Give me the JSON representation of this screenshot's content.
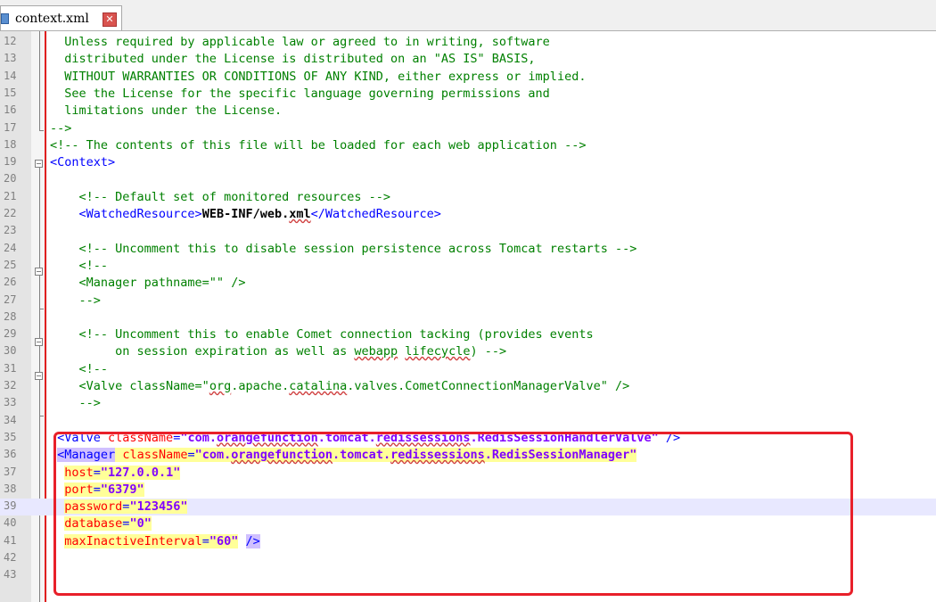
{
  "tab": {
    "title": "context.xml",
    "icon": "xml-file-icon",
    "close_icon": "close-icon"
  },
  "colors": {
    "comment": "#008000",
    "tag": "#0000ff",
    "attr": "#ff0000",
    "value": "#8000ff",
    "highlight": "#ffff99",
    "box": "#e8202a"
  },
  "lines": [
    {
      "n": "12",
      "segs": [
        {
          "t": "  Unless required by applicable law or agreed to in writing, software",
          "k": "c"
        }
      ]
    },
    {
      "n": "13",
      "segs": [
        {
          "t": "  distributed under the License is distributed on an \"AS IS\" BASIS,",
          "k": "c"
        }
      ]
    },
    {
      "n": "14",
      "segs": [
        {
          "t": "  WITHOUT WARRANTIES OR CONDITIONS OF ANY KIND, either express or implied.",
          "k": "c"
        }
      ]
    },
    {
      "n": "15",
      "segs": [
        {
          "t": "  See the License for the specific language governing permissions and",
          "k": "c"
        }
      ]
    },
    {
      "n": "16",
      "segs": [
        {
          "t": "  limitations under the License.",
          "k": "c"
        }
      ]
    },
    {
      "n": "17",
      "segs": [
        {
          "t": "-->",
          "k": "c"
        }
      ]
    },
    {
      "n": "18",
      "segs": [
        {
          "t": "<!-- The contents of this file will be loaded for each web application -->",
          "k": "c"
        }
      ]
    },
    {
      "n": "19",
      "segs": [
        {
          "t": "<Context>",
          "k": "t"
        }
      ]
    },
    {
      "n": "20",
      "segs": []
    },
    {
      "n": "21",
      "segs": [
        {
          "t": "    <!-- Default set of monitored resources -->",
          "k": "c"
        }
      ]
    },
    {
      "n": "22",
      "segs": [
        {
          "t": "    <WatchedResource>",
          "k": "t"
        },
        {
          "t": "WEB-INF/web.",
          "k": "b"
        },
        {
          "t": "xml",
          "k": "bsq"
        },
        {
          "t": "</WatchedResource>",
          "k": "t"
        }
      ]
    },
    {
      "n": "23",
      "segs": []
    },
    {
      "n": "24",
      "segs": [
        {
          "t": "    <!-- Uncomment this to disable session persistence across Tomcat restarts -->",
          "k": "c"
        }
      ]
    },
    {
      "n": "25",
      "segs": [
        {
          "t": "    <!--",
          "k": "c"
        }
      ]
    },
    {
      "n": "26",
      "segs": [
        {
          "t": "    <Manager pathname=\"\" />",
          "k": "c"
        }
      ]
    },
    {
      "n": "27",
      "segs": [
        {
          "t": "    -->",
          "k": "c"
        }
      ]
    },
    {
      "n": "28",
      "segs": []
    },
    {
      "n": "29",
      "segs": [
        {
          "t": "    <!-- Uncomment this to enable Comet connection tacking (provides events",
          "k": "c"
        }
      ]
    },
    {
      "n": "30",
      "segs": [
        {
          "t": "         on session expiration as well as ",
          "k": "c"
        },
        {
          "t": "webapp",
          "k": "csq"
        },
        {
          "t": " ",
          "k": "c"
        },
        {
          "t": "lifecycle",
          "k": "csq"
        },
        {
          "t": ") -->",
          "k": "c"
        }
      ]
    },
    {
      "n": "31",
      "segs": [
        {
          "t": "    <!--",
          "k": "c"
        }
      ]
    },
    {
      "n": "32",
      "segs": [
        {
          "t": "    <Valve className=\"",
          "k": "c"
        },
        {
          "t": "org",
          "k": "csq"
        },
        {
          "t": ".apache.",
          "k": "c"
        },
        {
          "t": "catalina",
          "k": "csq"
        },
        {
          "t": ".valves.CometConnectionManagerValve\" />",
          "k": "c"
        }
      ]
    },
    {
      "n": "33",
      "segs": [
        {
          "t": "    -->",
          "k": "c"
        }
      ]
    },
    {
      "n": "34",
      "segs": []
    },
    {
      "n": "35",
      "segs": [
        {
          "t": " <Valve ",
          "k": "t"
        },
        {
          "t": "className",
          "k": "a"
        },
        {
          "t": "=",
          "k": "t"
        },
        {
          "t": "\"com.",
          "k": "v"
        },
        {
          "t": "orangefunction",
          "k": "vsq"
        },
        {
          "t": ".tomcat.",
          "k": "v"
        },
        {
          "t": "redissessions",
          "k": "vsq"
        },
        {
          "t": ".RedisSessionHandlerValve\"",
          "k": "v"
        },
        {
          "t": " />",
          "k": "t"
        }
      ]
    },
    {
      "n": "36",
      "segs": [
        {
          "t": " ",
          "k": "t"
        },
        {
          "t": "<Manager",
          "k": "thp"
        },
        {
          "t": " ",
          "k": "thl"
        },
        {
          "t": "className",
          "k": "ahl"
        },
        {
          "t": "=",
          "k": "thl"
        },
        {
          "t": "\"com.",
          "k": "vhl"
        },
        {
          "t": "orangefunction",
          "k": "vhlsq"
        },
        {
          "t": ".tomcat.",
          "k": "vhl"
        },
        {
          "t": "redissessions",
          "k": "vhlsq"
        },
        {
          "t": ".RedisSessionManager\"",
          "k": "vhl"
        }
      ]
    },
    {
      "n": "37",
      "segs": [
        {
          "t": "  ",
          "k": "t"
        },
        {
          "t": "host",
          "k": "ahl"
        },
        {
          "t": "=",
          "k": "thl"
        },
        {
          "t": "\"127.0.0.1\"",
          "k": "vhl"
        }
      ]
    },
    {
      "n": "38",
      "segs": [
        {
          "t": "  ",
          "k": "t"
        },
        {
          "t": "port",
          "k": "ahl"
        },
        {
          "t": "=",
          "k": "thl"
        },
        {
          "t": "\"6379\"",
          "k": "vhl"
        }
      ]
    },
    {
      "n": "39",
      "segs": [
        {
          "t": "  ",
          "k": "t"
        },
        {
          "t": "password",
          "k": "ahl"
        },
        {
          "t": "=",
          "k": "thl"
        },
        {
          "t": "\"123456\"",
          "k": "vhl"
        }
      ],
      "current": true
    },
    {
      "n": "40",
      "segs": [
        {
          "t": "  ",
          "k": "t"
        },
        {
          "t": "database",
          "k": "ahl"
        },
        {
          "t": "=",
          "k": "thl"
        },
        {
          "t": "\"0\"",
          "k": "vhl"
        }
      ]
    },
    {
      "n": "41",
      "segs": [
        {
          "t": "  ",
          "k": "t"
        },
        {
          "t": "maxInactiveInterval",
          "k": "ahl"
        },
        {
          "t": "=",
          "k": "thl"
        },
        {
          "t": "\"60\"",
          "k": "vhl"
        },
        {
          "t": " ",
          "k": "t"
        },
        {
          "t": "/>",
          "k": "thp"
        }
      ]
    },
    {
      "n": "42",
      "segs": []
    },
    {
      "n": "43",
      "segs": []
    }
  ]
}
